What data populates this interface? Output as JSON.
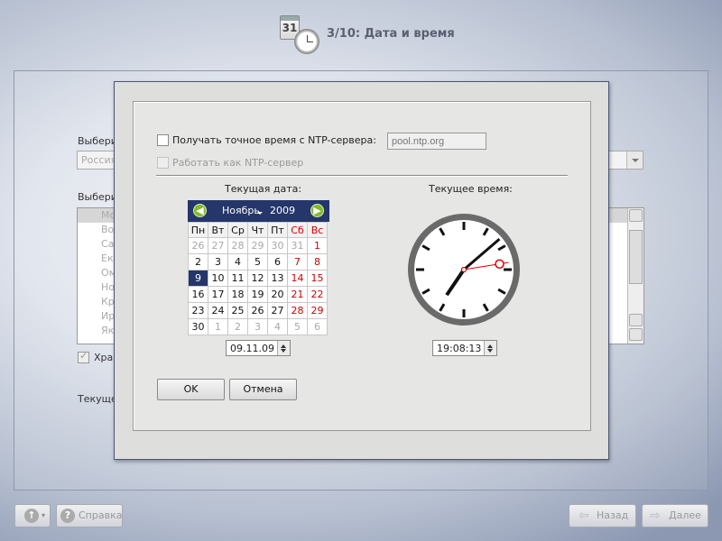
{
  "header": {
    "title": "3/10: Дата и время",
    "calendar_icon_day": "31"
  },
  "background": {
    "label_select_region": "Выбери",
    "region_combo_value": "Россия",
    "label_select_zone": "Выбери",
    "zone_list": [
      "Мо",
      "Во",
      "Са",
      "Ек",
      "Ом",
      "Но",
      "Кр",
      "Ир",
      "Як"
    ],
    "checkbox_label": "Хра",
    "current_label": "Текуще"
  },
  "dialog": {
    "ntp_checkbox_label": "Получать точное время с NTP-сервера:",
    "ntp_server_placeholder": "pool.ntp.org",
    "ntp_server_value": "",
    "work_as_server_label": "Работать как NTP-сервер",
    "ntp_checked": false,
    "work_as_server_checked": false,
    "current_date_label": "Текущая дата:",
    "current_time_label": "Текущее время:",
    "calendar": {
      "month": "Ноябрь",
      "year": "2009",
      "weekdays": [
        "Пн",
        "Вт",
        "Ср",
        "Чт",
        "Пт",
        "Сб",
        "Вс"
      ],
      "weeks": [
        [
          "26",
          "27",
          "28",
          "29",
          "30",
          "31",
          "1"
        ],
        [
          "2",
          "3",
          "4",
          "5",
          "6",
          "7",
          "8"
        ],
        [
          "9",
          "10",
          "11",
          "12",
          "13",
          "14",
          "15"
        ],
        [
          "16",
          "17",
          "18",
          "19",
          "20",
          "21",
          "22"
        ],
        [
          "23",
          "24",
          "25",
          "26",
          "27",
          "28",
          "29"
        ],
        [
          "30",
          "1",
          "2",
          "3",
          "4",
          "5",
          "6"
        ]
      ],
      "selected_day": "9",
      "weekend_color": "#d00000",
      "header_color": "#25366a"
    },
    "date_value": "09.11.09",
    "time_value": "19:08:13",
    "ok_label": "OK",
    "cancel_label": "Отмена"
  },
  "footer": {
    "help_label": "Справка",
    "back_label": "Назад",
    "next_label": "Далее"
  }
}
